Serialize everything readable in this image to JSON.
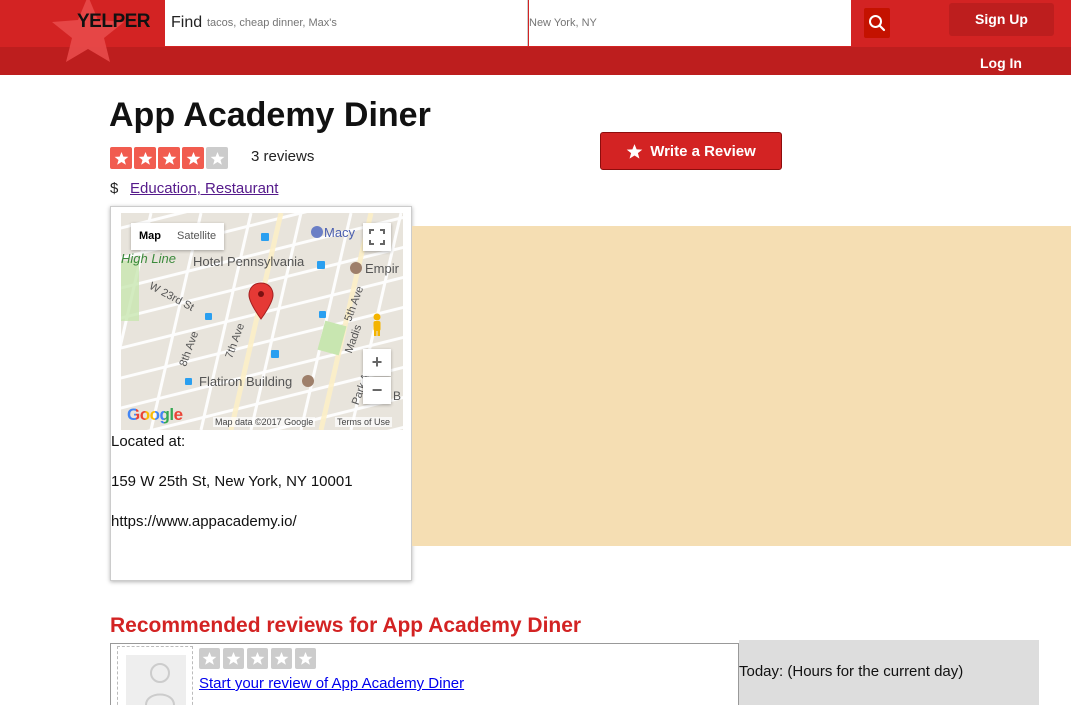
{
  "header": {
    "logo": "YELPER",
    "find_label": "Find",
    "find_placeholder": "tacos, cheap dinner, Max's",
    "near_placeholder": "New York, NY",
    "signup_label": "Sign Up",
    "login_label": "Log In"
  },
  "business": {
    "name": "App Academy Diner",
    "rating": 4,
    "max_rating": 5,
    "review_count_text": "3 reviews",
    "price": "$",
    "categories_text": "Education, Restaurant",
    "write_review_label": "Write a Review"
  },
  "map": {
    "toggle_map": "Map",
    "toggle_satellite": "Satellite",
    "labels": {
      "macys": "Macy",
      "high_line": "High Line",
      "hotel_pennsylvania": "Hotel Pennsylvania",
      "empire": "Empir",
      "w23rd": "W 23rd St",
      "flatiron": "Flatiron Building",
      "fifth_ave": "5th Ave",
      "madison": "Madis",
      "park_ave": "Park Ave",
      "eighth_ave": "8th Ave",
      "seventh_ave": "7th Ave",
      "edge_b": "B"
    },
    "google": "Google",
    "credit": "Map data ©2017 Google",
    "terms": "Terms of Use",
    "zoom_in": "+",
    "zoom_out": "−"
  },
  "location": {
    "located_label": "Located at:",
    "address": "159 W 25th St, New York, NY 10001",
    "website": "https://www.appacademy.io/"
  },
  "reviews": {
    "section_title": "Recommended reviews for App Academy Diner",
    "start_review_link": "Start your review of App Academy Diner"
  },
  "hours": {
    "text": "Today: (Hours for the current day)"
  },
  "colors": {
    "brand_red": "#d32323",
    "star_on": "#f15c4f",
    "star_off": "#cccccc",
    "photo_placeholder": "#f5deb3"
  }
}
